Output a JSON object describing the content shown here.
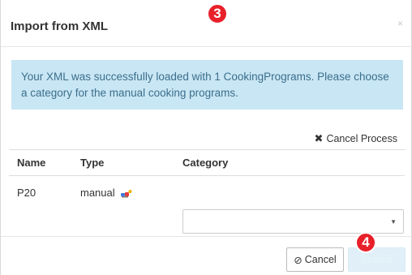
{
  "dialog": {
    "title": "Import from XML",
    "close_glyph": "×",
    "badges": {
      "top": "3",
      "bottom": "4"
    },
    "badge_color": "#e8202a"
  },
  "alert": {
    "message": "Your XML was successfully loaded with 1 CookingPrograms. Please choose a category for the manual cooking programs.",
    "background": "#c9e6f4"
  },
  "actions": {
    "cancel_process_label": "Cancel Process"
  },
  "table": {
    "headers": {
      "name": "Name",
      "type": "Type",
      "category": "Category"
    },
    "rows": [
      {
        "name": "P20",
        "type": "manual",
        "type_icon": "manual-program-icon",
        "category": ""
      }
    ]
  },
  "footer": {
    "cancel_label": "Cancel",
    "submit_label": "Submit"
  }
}
